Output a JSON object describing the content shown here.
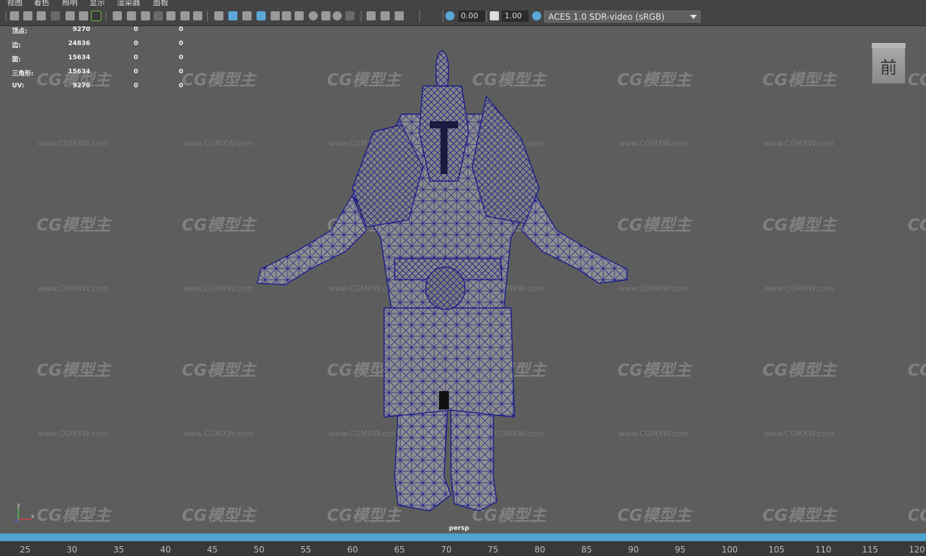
{
  "menu": [
    "视图",
    "着色",
    "照明",
    "显示",
    "渲染器",
    "面板"
  ],
  "toolbar": {
    "icons": [
      "camera-select-icon",
      "camera-attributes-icon",
      "bookmark-icon",
      "image-plane-icon",
      "2d-pan-zoom-icon",
      "grease-pencil-icon",
      "grid-icon",
      "film-gate-icon",
      "resolution-gate-icon",
      "gate-mask-icon",
      "field-chart-icon",
      "safe-action-icon",
      "safe-title-icon",
      "wireframe-icon",
      "smooth-shade-icon",
      "default-material-icon",
      "wireframe-on-shaded-icon",
      "xray-icon",
      "use-all-lights-icon",
      "shadows-icon",
      "screen-space-ao-icon",
      "motion-blur-icon",
      "multisample-aa-icon",
      "depth-of-field-icon",
      "isolate-select-icon",
      "xray-active-icon",
      "xray-joints-icon",
      "backface-culling-icon",
      "exposure-icon",
      "gamma-icon",
      "color-management-icon"
    ],
    "exposure_value": "0.00",
    "gamma_value": "1.00",
    "color_management": "ACES 1.0 SDR-video (sRGB)"
  },
  "hud": [
    {
      "label": "顶点:",
      "v1": "9270",
      "v2": "0",
      "v3": "0"
    },
    {
      "label": "边:",
      "v1": "24836",
      "v2": "0",
      "v3": "0"
    },
    {
      "label": "面:",
      "v1": "15634",
      "v2": "0",
      "v3": "0"
    },
    {
      "label": "三角形:",
      "v1": "15634",
      "v2": "0",
      "v3": "0"
    },
    {
      "label": "UV:",
      "v1": "9270",
      "v2": "0",
      "v3": "0"
    }
  ],
  "watermark": {
    "logo": "CG模型主",
    "url": "www.CGMXW.com"
  },
  "viewcube_label": "前",
  "camera_label": "persp",
  "axis": {
    "x": "x",
    "y": "y"
  },
  "timeline": {
    "ticks": [
      "25",
      "30",
      "35",
      "40",
      "45",
      "50",
      "55",
      "60",
      "65",
      "70",
      "75",
      "80",
      "85",
      "90",
      "95",
      "100",
      "105",
      "110",
      "115",
      "120"
    ]
  },
  "colors": {
    "wire": "#1a1a8c",
    "mesh": "#8e8e8e",
    "timebar": "#4ea3cf",
    "viewport_bg": "#5d5d5d"
  }
}
